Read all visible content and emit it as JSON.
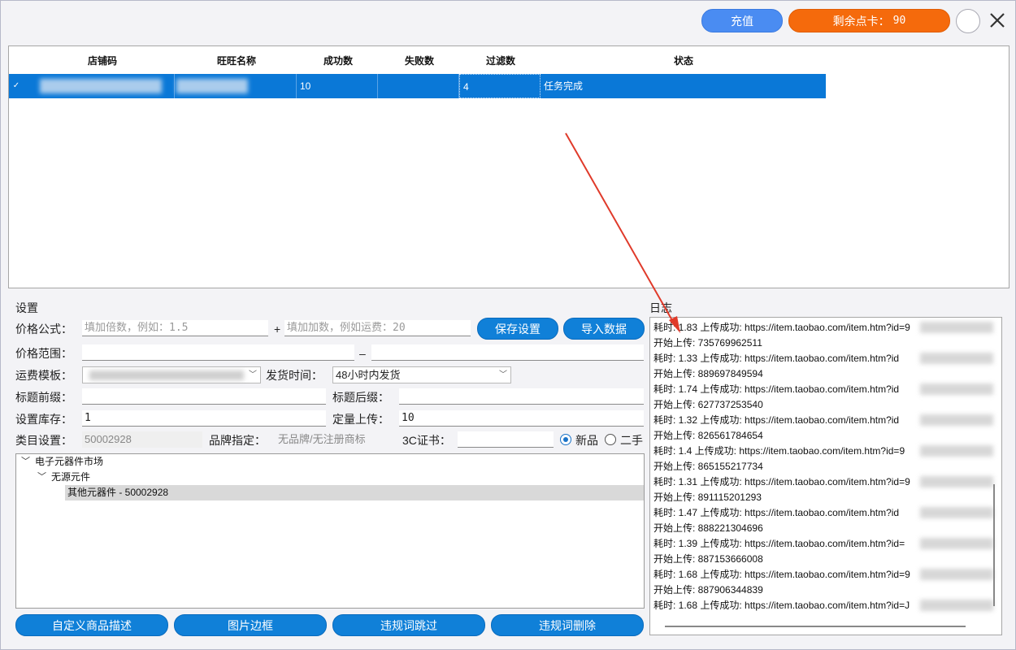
{
  "topbar": {
    "recharge_label": "充值",
    "credits_label": "剩余点卡：",
    "credits_value": "90"
  },
  "task_table": {
    "columns": [
      "店铺码",
      "旺旺名称",
      "成功数",
      "失败数",
      "过滤数",
      "状态"
    ],
    "rows": [
      {
        "store_code": "",
        "wangwang": "",
        "success": "10",
        "fail": "",
        "filtered": "4",
        "status": "任务完成"
      }
    ]
  },
  "settings": {
    "section_title": "设置",
    "price_formula_label": "价格公式：",
    "multiplier_placeholder": "填加倍数，例如：1.5",
    "plus_sign": "+",
    "addition_placeholder": "填加加数，例如运费：20",
    "save_button": "保存设置",
    "import_button": "导入数据",
    "price_range_label": "价格范围：",
    "range_dash": "–",
    "shipping_template_label": "运费模板：",
    "ship_time_label": "发货时间：",
    "ship_time_value": "48小时内发货",
    "title_prefix_label": "标题前缀：",
    "title_suffix_label": "标题后缀：",
    "stock_label": "设置库存：",
    "stock_value": "1",
    "quota_label": "定量上传：",
    "quota_value": "10",
    "category_label": "类目设置：",
    "category_value": "50002928",
    "brand_label": "品牌指定：",
    "brand_value": "无品牌/无注册商标",
    "cert_label": "3C证书：",
    "condition_new": "新品",
    "condition_used": "二手"
  },
  "tree": {
    "root": "电子元器件市场",
    "child": "无源元件",
    "leaf": "其他元器件 - 50002928"
  },
  "log": {
    "title": "日志",
    "lines": [
      "耗时: 1.83 上传成功: https://item.taobao.com/item.htm?id=9",
      "开始上传: 735769962511",
      "耗时: 1.33 上传成功: https://item.taobao.com/item.htm?id",
      "开始上传: 889697849594",
      "耗时: 1.74 上传成功: https://item.taobao.com/item.htm?id",
      "开始上传: 627737253540",
      "耗时: 1.32 上传成功: https://item.taobao.com/item.htm?id",
      "开始上传: 826561784654",
      "耗时: 1.4 上传成功: https://item.taobao.com/item.htm?id=9",
      "开始上传: 865155217734",
      "耗时: 1.31 上传成功: https://item.taobao.com/item.htm?id=9",
      "开始上传: 891115201293",
      "耗时: 1.47 上传成功: https://item.taobao.com/item.htm?id",
      "开始上传: 888221304696",
      "耗时: 1.39 上传成功: https://item.taobao.com/item.htm?id=",
      "开始上传: 887153666008",
      "耗时: 1.68 上传成功: https://item.taobao.com/item.htm?id=9",
      "开始上传: 887906344839",
      "耗时: 1.68 上传成功: https://item.taobao.com/item.htm?id=J"
    ]
  },
  "bottom_buttons": [
    "自定义商品描述",
    "图片边框",
    "违规词跳过",
    "违规词删除"
  ],
  "colors": {
    "accent_blue": "#1080d8",
    "recharge_blue": "#4a8cf2",
    "credits_orange": "#f56a0c",
    "selection_blue": "#0a78d7",
    "annotation_arrow": "#e03a2a"
  }
}
